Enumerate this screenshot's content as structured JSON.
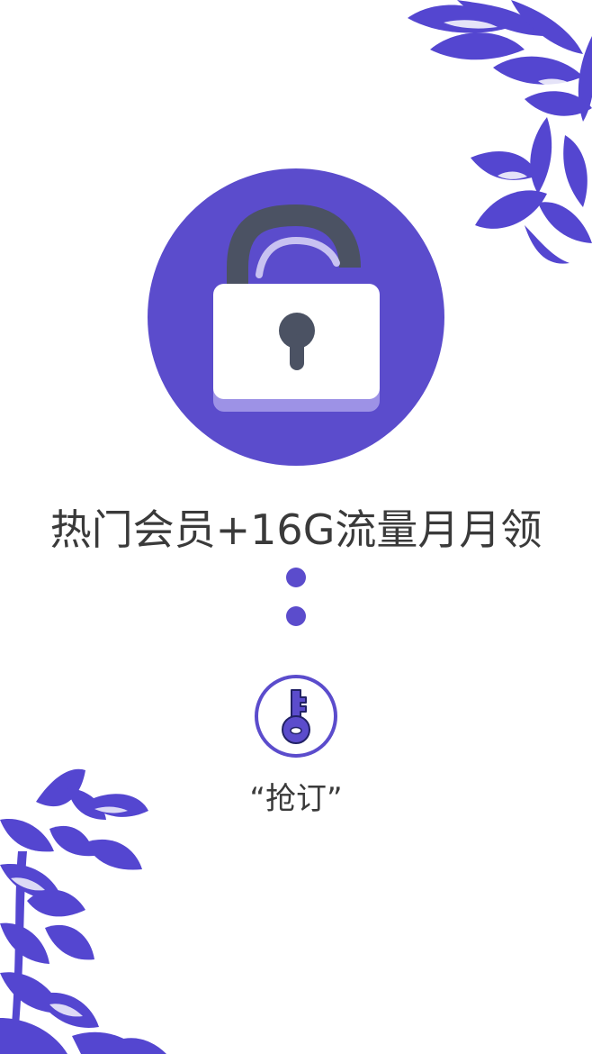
{
  "colors": {
    "accent": "#5b4ccc",
    "leaf": "#5446d0",
    "lock_body": "#ffffff",
    "lock_shadow": "#9d92e6",
    "shackle": "#4b5263",
    "text": "#3a3a3a"
  },
  "icons": {
    "lock": "unlocked-padlock-icon",
    "key": "key-icon",
    "leaves": "leaf-branch-decoration"
  },
  "main": {
    "headline": "热门会员+16G流量月月领",
    "cta_label": "“抢订”"
  }
}
